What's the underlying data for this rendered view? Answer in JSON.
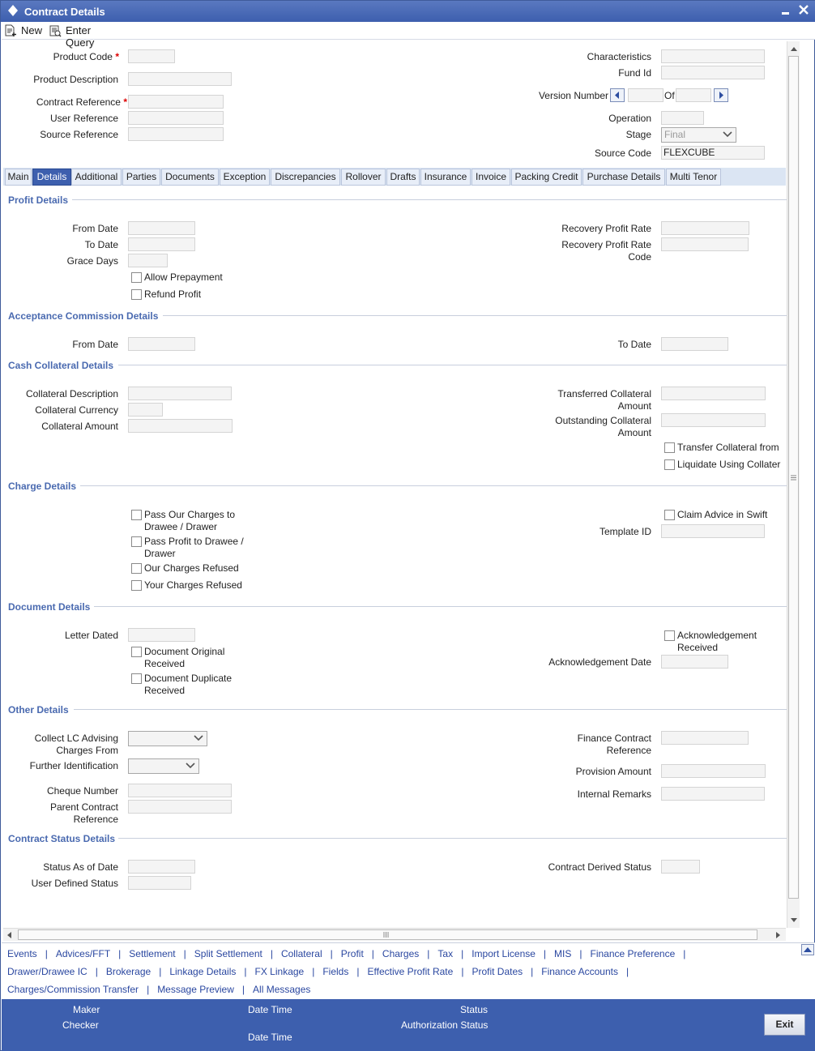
{
  "window": {
    "title": "Contract Details"
  },
  "toolbar": {
    "new_label": "New",
    "enter_query_label": "Enter Query"
  },
  "header": {
    "product_code_label": "Product Code",
    "product_description_label": "Product Description",
    "contract_reference_label": "Contract Reference",
    "user_reference_label": "User Reference",
    "source_reference_label": "Source Reference",
    "characteristics_label": "Characteristics",
    "fund_id_label": "Fund Id",
    "version_number_label": "Version Number",
    "of_label": "Of",
    "operation_label": "Operation",
    "stage_label": "Stage",
    "stage_value": "Final",
    "source_code_label": "Source Code",
    "source_code_value": "FLEXCUBE",
    "required_mark": "*"
  },
  "tabs": [
    "Main",
    "Details",
    "Additional",
    "Parties",
    "Documents",
    "Exception",
    "Discrepancies",
    "Rollover",
    "Drafts",
    "Insurance",
    "Invoice",
    "Packing Credit",
    "Purchase Details",
    "Multi Tenor"
  ],
  "active_tab": "Details",
  "profit": {
    "title": "Profit Details",
    "from_date": "From Date",
    "to_date": "To Date",
    "grace_days": "Grace Days",
    "allow_prepayment": "Allow Prepayment",
    "refund_profit": "Refund Profit",
    "recovery_profit_rate": "Recovery Profit Rate",
    "recovery_profit_rate_code_1": "Recovery Profit Rate",
    "recovery_profit_rate_code_2": "Code"
  },
  "acceptance": {
    "title": "Acceptance Commission Details",
    "from_date": "From Date",
    "to_date": "To Date"
  },
  "cash": {
    "title": "Cash Collateral Details",
    "collateral_description": "Collateral Description",
    "collateral_currency": "Collateral Currency",
    "collateral_amount": "Collateral Amount",
    "transferred_1": "Transferred Collateral",
    "transferred_2": "Amount",
    "outstanding_1": "Outstanding Collateral",
    "outstanding_2": "Amount",
    "transfer_from": "Transfer Collateral from",
    "liquidate_using": "Liquidate Using Collater"
  },
  "charge": {
    "title": "Charge Details",
    "pass_our_1": "Pass Our Charges to",
    "pass_our_2": "Drawee / Drawer",
    "pass_profit_1": "Pass Profit to Drawee /",
    "pass_profit_2": "Drawer",
    "our_refused": "Our Charges Refused",
    "your_refused": "Your Charges Refused",
    "claim_advice": "Claim Advice in Swift",
    "template_id": "Template ID"
  },
  "document": {
    "title": "Document Details",
    "letter_dated": "Letter Dated",
    "orig_1": "Document Original",
    "orig_2": "Received",
    "dup_1": "Document Duplicate",
    "dup_2": "Received",
    "ack_1": "Acknowledgement",
    "ack_2": "Received",
    "ack_date": "Acknowledgement Date"
  },
  "other": {
    "title": "Other Details",
    "collect_1": "Collect LC Advising",
    "collect_2": "Charges From",
    "further_id": "Further Identification",
    "cheque_number": "Cheque Number",
    "parent_1": "Parent Contract",
    "parent_2": "Reference",
    "finance_1": "Finance Contract",
    "finance_2": "Reference",
    "provision_amount": "Provision Amount",
    "internal_remarks": "Internal Remarks"
  },
  "status": {
    "title": "Contract Status Details",
    "status_as_of": "Status As of Date",
    "user_defined": "User Defined Status",
    "derived": "Contract Derived Status"
  },
  "links": [
    [
      "Events",
      "Advices/FFT",
      "Settlement",
      "Split Settlement",
      "Collateral",
      "Profit",
      "Charges",
      "Tax",
      "Import License",
      "MIS",
      "Finance Preference"
    ],
    [
      "Drawer/Drawee IC",
      "Brokerage",
      "Linkage Details",
      "FX Linkage",
      "Fields",
      "Effective Profit Rate",
      "Profit Dates",
      "Finance Accounts"
    ],
    [
      "Charges/Commission Transfer",
      "Message Preview",
      "All Messages"
    ]
  ],
  "footer": {
    "maker": "Maker",
    "checker": "Checker",
    "date_time_1": "Date Time",
    "date_time_2": "Date Time",
    "status": "Status",
    "authorization_status": "Authorization Status",
    "exit": "Exit"
  },
  "colors": {
    "titlebar": "#3d5fae",
    "section_title": "#4a6ab0",
    "link": "#2a47a0",
    "active_tab": "#3d5fae"
  }
}
